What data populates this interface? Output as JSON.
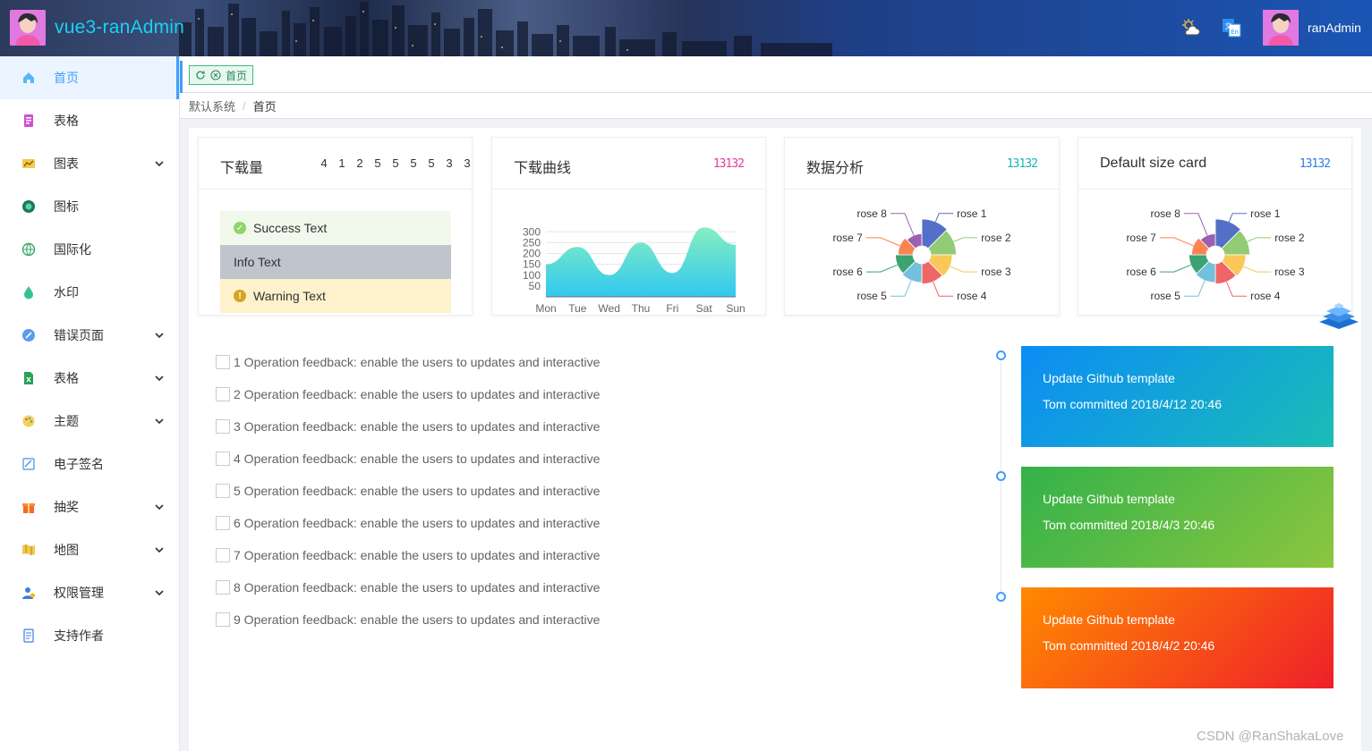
{
  "header": {
    "app_title": "vue3-ranAdmin",
    "user_name": "ranAdmin",
    "icons": [
      "weather-icon",
      "translate-icon"
    ]
  },
  "sidebar": {
    "items": [
      {
        "label": "首页",
        "icon": "home-icon",
        "active": true,
        "has_arrow": false
      },
      {
        "label": "表格",
        "icon": "table-icon",
        "has_arrow": false
      },
      {
        "label": "图表",
        "icon": "chart-icon",
        "has_arrow": true
      },
      {
        "label": "图标",
        "icon": "icon-icon",
        "has_arrow": false
      },
      {
        "label": "国际化",
        "icon": "globe-icon",
        "has_arrow": false
      },
      {
        "label": "水印",
        "icon": "watermark-icon",
        "has_arrow": false
      },
      {
        "label": "错误页面",
        "icon": "error-icon",
        "has_arrow": true
      },
      {
        "label": "表格",
        "icon": "excel-icon",
        "has_arrow": true
      },
      {
        "label": "主题",
        "icon": "theme-icon",
        "has_arrow": true
      },
      {
        "label": "电子签名",
        "icon": "signature-icon",
        "has_arrow": false
      },
      {
        "label": "抽奖",
        "icon": "gift-icon",
        "has_arrow": true
      },
      {
        "label": "地图",
        "icon": "map-icon",
        "has_arrow": true
      },
      {
        "label": "权限管理",
        "icon": "permission-icon",
        "has_arrow": true
      },
      {
        "label": "支持作者",
        "icon": "support-icon",
        "has_arrow": false
      }
    ]
  },
  "tabs": {
    "active_tab": "首页"
  },
  "breadcrumb": {
    "root": "默认系统",
    "separator": "/",
    "current": "首页"
  },
  "cards": {
    "downloads": {
      "title": "下载量",
      "digits": [
        "4",
        "1",
        "2",
        "5",
        "5",
        "5",
        "5",
        "3",
        "3"
      ],
      "alerts": {
        "success": "Success Text",
        "info": "Info Text",
        "warning": "Warning Text"
      }
    },
    "download_curve": {
      "title": "下载曲线",
      "extra": "13132",
      "extra_color": "#e6399b"
    },
    "data_analysis": {
      "title": "数据分析",
      "extra": "13132",
      "extra_color": "#13b5b1"
    },
    "default_size": {
      "title": "Default size card",
      "extra": "13132",
      "extra_color": "#2d7be5"
    }
  },
  "chart_data": [
    {
      "type": "area",
      "title": "",
      "categories": [
        "Mon",
        "Tue",
        "Wed",
        "Thu",
        "Fri",
        "Sat",
        "Sun"
      ],
      "values": [
        150,
        230,
        100,
        250,
        110,
        320,
        240
      ],
      "yticks": [
        50,
        100,
        150,
        200,
        250,
        300
      ],
      "ylim": [
        0,
        330
      ],
      "gradient": [
        "#86efc0",
        "#31c8f0"
      ]
    },
    {
      "type": "pie",
      "rose_type": true,
      "labels": [
        "rose 1",
        "rose 2",
        "rose 3",
        "rose 4",
        "rose 5",
        "rose 6",
        "rose 7",
        "rose 8"
      ],
      "values": [
        40,
        38,
        32,
        30,
        28,
        26,
        22,
        18
      ],
      "colors": [
        "#5470c6",
        "#91cc75",
        "#fac858",
        "#ee6666",
        "#73c0de",
        "#3ba272",
        "#fc8452",
        "#9a60b4"
      ]
    },
    {
      "type": "pie",
      "rose_type": true,
      "labels": [
        "rose 1",
        "rose 2",
        "rose 3",
        "rose 4",
        "rose 5",
        "rose 6",
        "rose 7",
        "rose 8"
      ],
      "values": [
        40,
        38,
        32,
        30,
        28,
        26,
        22,
        18
      ],
      "colors": [
        "#5470c6",
        "#91cc75",
        "#fac858",
        "#ee6666",
        "#73c0de",
        "#3ba272",
        "#fc8452",
        "#9a60b4"
      ]
    }
  ],
  "checklist": [
    "1 Operation feedback: enable the users to updates and interactive",
    "2 Operation feedback: enable the users to updates and interactive",
    "3 Operation feedback: enable the users to updates and interactive",
    "4 Operation feedback: enable the users to updates and interactive",
    "5 Operation feedback: enable the users to updates and interactive",
    "6 Operation feedback: enable the users to updates and interactive",
    "7 Operation feedback: enable the users to updates and interactive",
    "8 Operation feedback: enable the users to updates and interactive",
    "9 Operation feedback: enable the users to updates and interactive"
  ],
  "timeline": [
    {
      "title": "Update Github template",
      "detail": "Tom committed 2018/4/12 20:46",
      "gradient": [
        "#0b8df5",
        "#1bbcb6"
      ]
    },
    {
      "title": "Update Github template",
      "detail": "Tom committed 2018/4/3 20:46",
      "gradient": [
        "#33b24a",
        "#8cc63f"
      ]
    },
    {
      "title": "Update Github template",
      "detail": "Tom committed 2018/4/2 20:46",
      "gradient": [
        "#ff8a00",
        "#ef1f2a"
      ]
    }
  ],
  "watermark": "CSDN @RanShakaLove"
}
